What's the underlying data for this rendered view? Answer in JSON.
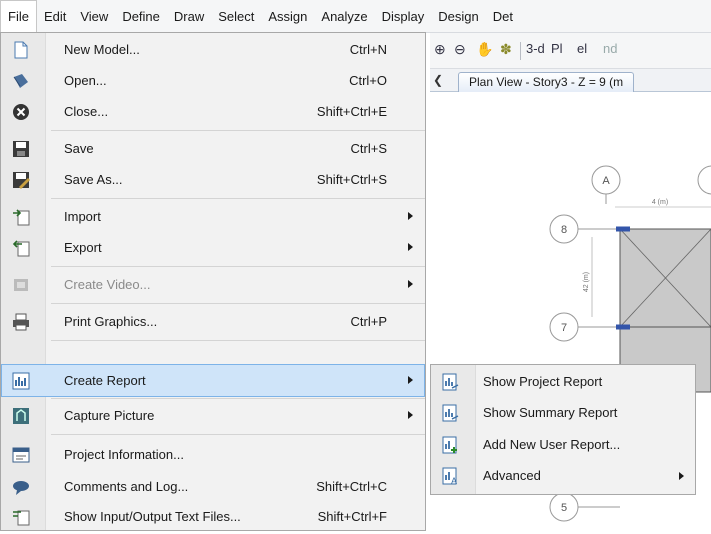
{
  "menubar": {
    "items": [
      "File",
      "Edit",
      "View",
      "Define",
      "Draw",
      "Select",
      "Assign",
      "Analyze",
      "Display",
      "Design",
      "Det"
    ]
  },
  "toolbar": {
    "btn_3d": "3-d",
    "btn_pln": "Pl",
    "btn_elv": "el",
    "btn_nd": "nd"
  },
  "view": {
    "tab_title": "Plan View - Story3 - Z = 9 (m",
    "grid_labels": {
      "col_a": "A",
      "row_8": "8",
      "row_7": "7",
      "row_5": "5"
    },
    "dim_top": "4 (m)",
    "dim_side": "42 (m)"
  },
  "file_menu": {
    "items": [
      {
        "label": "New Model...",
        "shortcut": "Ctrl+N",
        "icon": "new-model-icon"
      },
      {
        "label": "Open...",
        "shortcut": "Ctrl+O",
        "icon": "open-icon"
      },
      {
        "label": "Close...",
        "shortcut": "Shift+Ctrl+E",
        "icon": "close-icon"
      },
      {
        "label": "Save",
        "shortcut": "Ctrl+S",
        "icon": "save-icon"
      },
      {
        "label": "Save As...",
        "shortcut": "Shift+Ctrl+S",
        "icon": "save-as-icon"
      },
      {
        "label": "Import",
        "shortcut": "",
        "icon": "import-icon"
      },
      {
        "label": "Export",
        "shortcut": "",
        "icon": "export-icon"
      },
      {
        "label": "Create Video...",
        "shortcut": "",
        "icon": "video-icon"
      },
      {
        "label": "Print Graphics...",
        "shortcut": "Ctrl+P",
        "icon": "printer-icon"
      },
      {
        "label": "Create Report",
        "shortcut": "",
        "icon": "report-icon"
      },
      {
        "label": "Capture Picture",
        "shortcut": "",
        "icon": "capture-picture-icon"
      },
      {
        "label": "Project Information...",
        "shortcut": "",
        "icon": "project-info-icon"
      },
      {
        "label": "Comments and Log...",
        "shortcut": "Shift+Ctrl+C",
        "icon": "comments-icon"
      },
      {
        "label": "Show Input/Output Text Files...",
        "shortcut": "Shift+Ctrl+F",
        "icon": "text-files-icon"
      }
    ]
  },
  "report_submenu": {
    "items": [
      {
        "label": "Show Project Report",
        "icon": "project-report-icon"
      },
      {
        "label": "Show Summary Report",
        "icon": "summary-report-icon"
      },
      {
        "label": "Add New User Report...",
        "icon": "add-report-icon"
      },
      {
        "label": "Advanced",
        "icon": "advanced-report-icon"
      }
    ]
  },
  "colors": {
    "highlight": "#cfe4f9",
    "highlight_border": "#7db3e8",
    "slab": "#c9c9c9",
    "beam_blue": "#3355aa"
  }
}
